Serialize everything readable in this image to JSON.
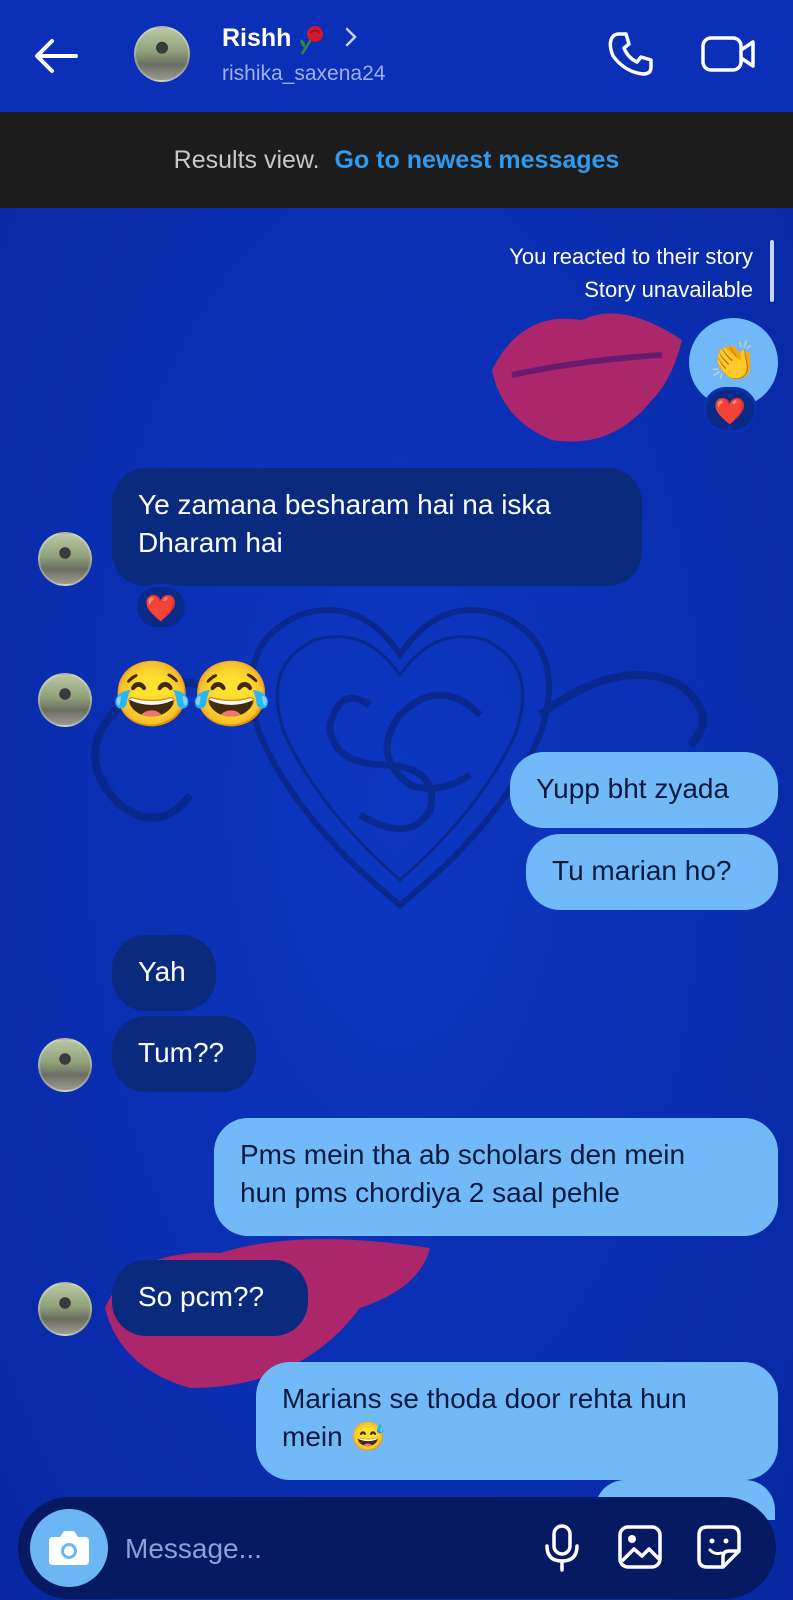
{
  "header": {
    "contact_name": "Rishh",
    "username": "rishika_saxena24",
    "icons": [
      "back-arrow-icon",
      "rose-icon",
      "chevron-right-icon",
      "phone-icon",
      "video-camera-icon"
    ]
  },
  "banner": {
    "text": "Results view.",
    "link": "Go to newest messages"
  },
  "story_reaction": {
    "line1": "You reacted to their story",
    "line2": "Story unavailable",
    "emoji": "👏",
    "reaction": "❤️"
  },
  "messages": [
    {
      "side": "in",
      "lines": [
        "Ye zamana besharam hai na iska",
        "Dharam hai"
      ],
      "reaction": "❤️"
    },
    {
      "side": "in",
      "emoji": "😂😂"
    },
    {
      "side": "out",
      "text": "Yupp bht zyada"
    },
    {
      "side": "out",
      "text": "Tu marian ho?"
    },
    {
      "side": "in",
      "text": "Yah"
    },
    {
      "side": "in",
      "text": "Tum??"
    },
    {
      "side": "out",
      "lines": [
        "Pms mein tha ab scholars den mein",
        "hun pms chordiya 2 saal pehle"
      ]
    },
    {
      "side": "in",
      "text": "So pcm??"
    },
    {
      "side": "out",
      "lines": [
        "Marians se thoda door rehta hun",
        "mein 😅"
      ]
    }
  ],
  "composer": {
    "placeholder": "Message...",
    "icons": [
      "camera-icon",
      "microphone-icon",
      "gallery-icon",
      "sticker-icon"
    ]
  },
  "colors": {
    "background": "#0b2fb6",
    "incoming_bubble": "#0a2a7e",
    "outgoing_bubble": "#72b9f8",
    "link": "#2f9bf0",
    "banner": "#1c1c1c"
  }
}
